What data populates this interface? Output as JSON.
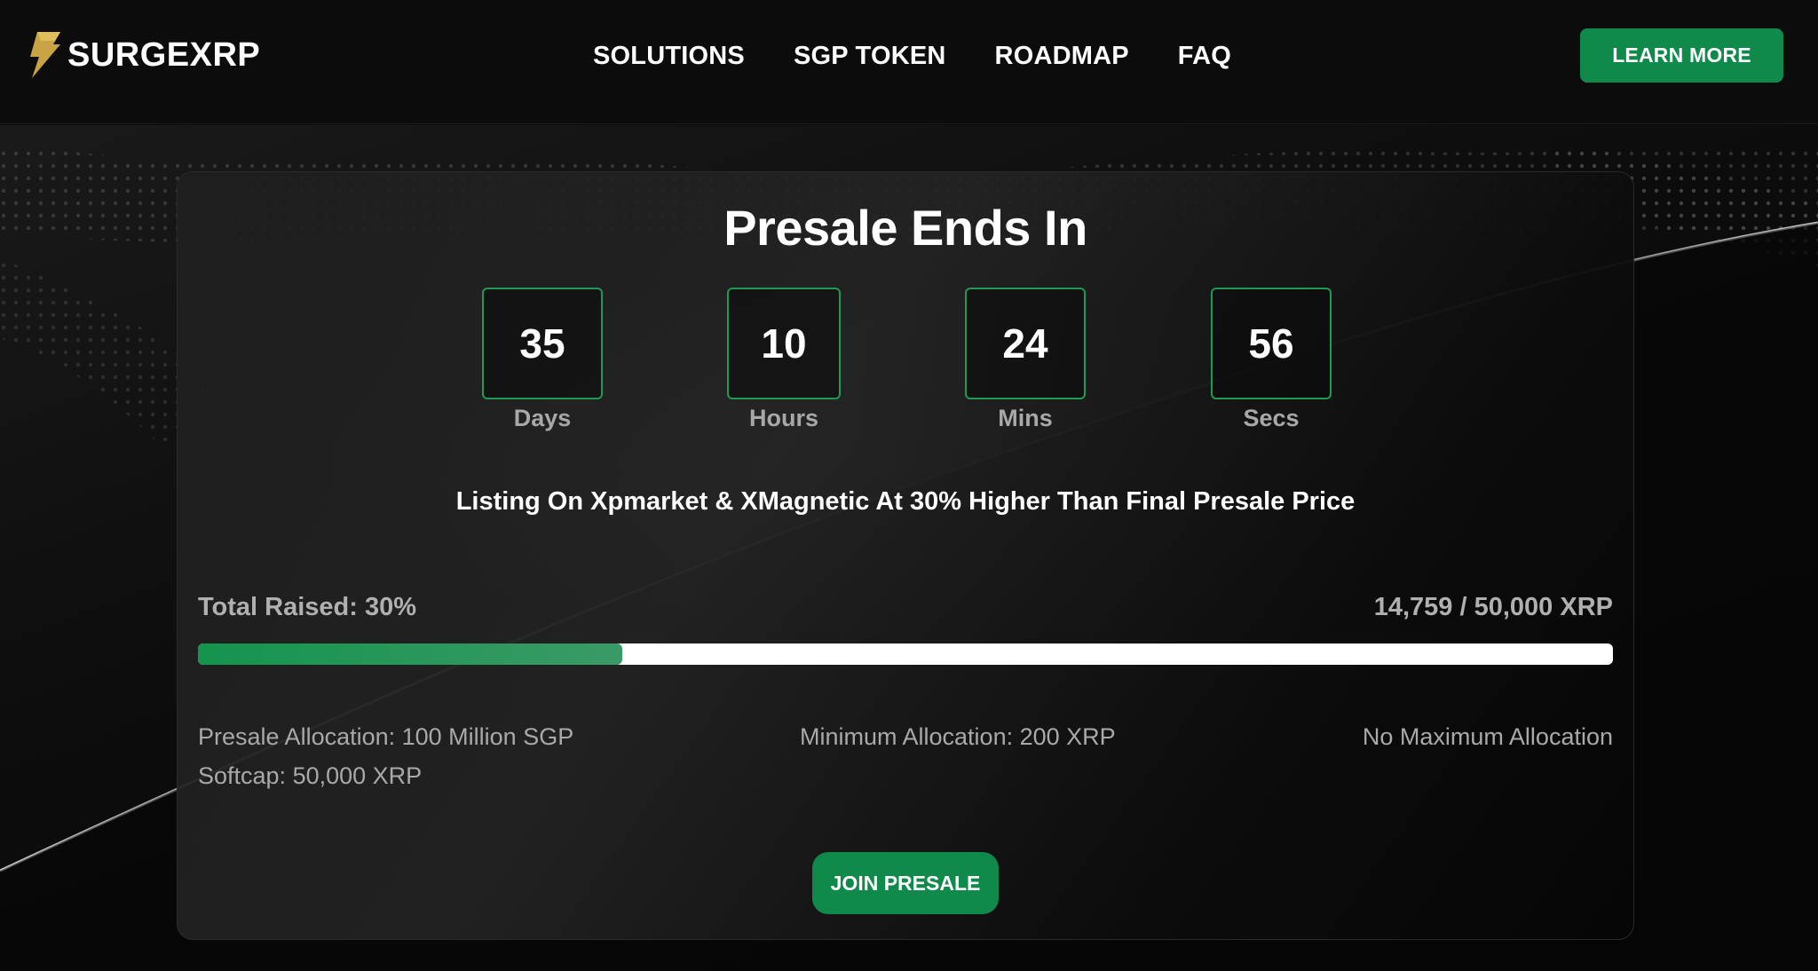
{
  "header": {
    "brand": "SURGEXRP",
    "nav": [
      "SOLUTIONS",
      "SGP TOKEN",
      "ROADMAP",
      "FAQ"
    ],
    "cta_label": "LEARN MORE"
  },
  "presale": {
    "title": "Presale Ends In",
    "countdown": [
      {
        "value": "35",
        "label": "Days"
      },
      {
        "value": "10",
        "label": "Hours"
      },
      {
        "value": "24",
        "label": "Mins"
      },
      {
        "value": "56",
        "label": "Secs"
      }
    ],
    "listing_text": "Listing On Xpmarket & XMagnetic At 30% Higher Than Final Presale Price",
    "raised_label": "Total Raised: 30%",
    "raised_amount": "14,759 / 50,000 XRP",
    "progress_fraction": 0.3,
    "info": {
      "allocation": "Presale Allocation: 100 Million SGP",
      "minimum": "Minimum Allocation: 200 XRP",
      "maximum": "No Maximum Allocation",
      "softcap": "Softcap: 50,000 XRP"
    },
    "join_label": "JOIN PRESALE"
  },
  "colors": {
    "accent_green": "#0f8a4a",
    "logo_gold": "#c9a445",
    "background": "#0b0b0b"
  },
  "icons": {
    "logo": "lightning-bolt-logo-icon"
  }
}
